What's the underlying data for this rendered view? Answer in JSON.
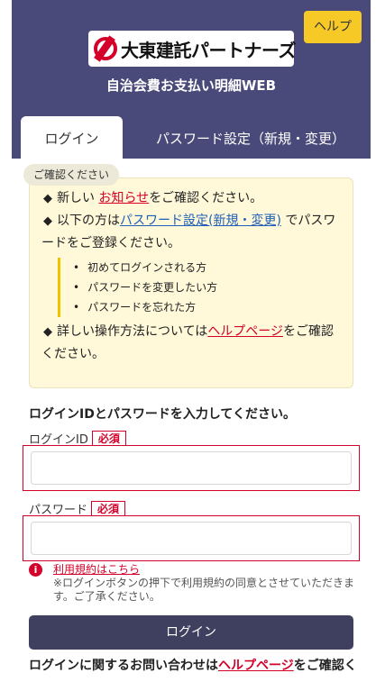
{
  "header": {
    "help_label": "ヘルプ",
    "logo_text": "大東建託パートナーズ",
    "subtitle": "自治会費お支払い明細WEB"
  },
  "tabs": [
    {
      "label": "ログイン",
      "active": true
    },
    {
      "label": "パスワード設定（新規・変更）",
      "active": false
    }
  ],
  "notice": {
    "tag": "ご確認ください",
    "line1_pre": "新しい ",
    "line1_link": "お知らせ",
    "line1_post": "をご確認ください。",
    "line2_pre": "以下の方は",
    "line2_link": "パスワード設定(新規・変更)",
    "line2_post": " でパスワードをご登録ください。",
    "bullets": [
      "初めてログインされる方",
      "パスワードを変更したい方",
      "パスワードを忘れた方"
    ],
    "line3_pre": "詳しい操作方法については",
    "line3_link": "ヘルプページ",
    "line3_post": "をご確認ください。"
  },
  "form": {
    "instruction": "ログインIDとパスワードを入力してください。",
    "id_label": "ログインID",
    "password_label": "パスワード",
    "required_label": "必須",
    "id_value": "",
    "password_value": ""
  },
  "terms": {
    "link": "利用規約はこちら",
    "note": "※ログインボタンの押下で利用規約の同意とさせていただきます。ご了承ください。"
  },
  "login_button": "ログイン",
  "contact": {
    "pre": "ログインに関するお問い合わせは",
    "link": "ヘルプページ",
    "post": "をご確認く"
  },
  "colors": {
    "header_bg": "#4a4a7a",
    "help_bg": "#f6c927",
    "accent_red": "#d4002a",
    "notice_bg": "#fff8d9",
    "button_bg": "#3f3f5f"
  }
}
